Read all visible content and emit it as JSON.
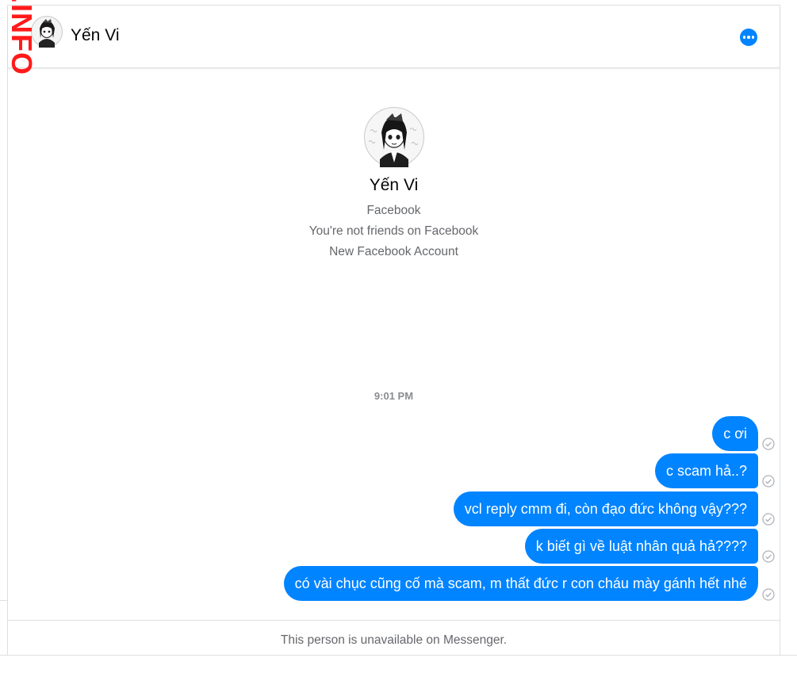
{
  "watermark": {
    "text": ".INFO"
  },
  "header": {
    "contact_name": "Yến Vi",
    "avatar_icon": "anime-girl-avatar-icon",
    "more_icon": "more-options-icon"
  },
  "profile": {
    "name": "Yến Vi",
    "line1": "Facebook",
    "line2": "You're not friends on Facebook",
    "line3": "New Facebook Account"
  },
  "conversation": {
    "timestamp": "9:01 PM",
    "messages": [
      {
        "text": "c ơi",
        "status_icon": "sent-check-icon"
      },
      {
        "text": "c scam hả..?",
        "status_icon": "sent-check-icon"
      },
      {
        "text": "vcl reply cmm đi, còn đạo đức không vậy???",
        "status_icon": "sent-check-icon"
      },
      {
        "text": "k biết gì về luật nhân quả hả????",
        "status_icon": "sent-check-icon"
      },
      {
        "text": "có vài chục cũng cố mà scam, m thất đức r con cháu mày gánh hết nhé",
        "status_icon": "sent-check-icon"
      }
    ]
  },
  "footer": {
    "text": "This person is unavailable on Messenger."
  },
  "colors": {
    "accent": "#0084ff",
    "watermark": "#ff1a1a",
    "muted_text": "#65676b"
  }
}
